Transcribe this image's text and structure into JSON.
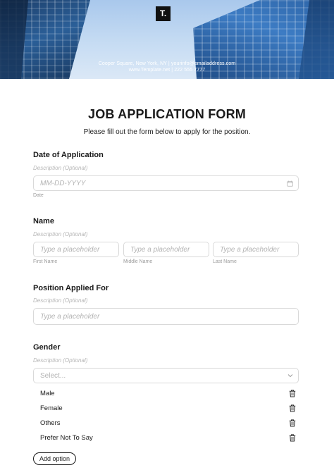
{
  "header": {
    "logo_letter": "T.",
    "contact_line1": "Cooper Square, New York, NY  |  yourinfo@emailaddress.com",
    "contact_line2": "www.Template.net  |  222 555 7777"
  },
  "form": {
    "title": "JOB APPLICATION FORM",
    "subtitle": "Please fill out the form below to apply for the position.",
    "date": {
      "label": "Date of Application",
      "description": "Description (Optional)",
      "placeholder": "MM-DD-YYYY",
      "sublabel": "Date"
    },
    "name": {
      "label": "Name",
      "description": "Description (Optional)",
      "fields": [
        {
          "placeholder": "Type a placeholder",
          "sublabel": "First Name"
        },
        {
          "placeholder": "Type a placeholder",
          "sublabel": "Middle Name"
        },
        {
          "placeholder": "Type a placeholder",
          "sublabel": "Last Name"
        }
      ]
    },
    "position": {
      "label": "Position Applied For",
      "description": "Description (Optional)",
      "placeholder": "Type a placeholder"
    },
    "gender": {
      "label": "Gender",
      "description": "Description (Optional)",
      "select_placeholder": "Select...",
      "options": [
        "Male",
        "Female",
        "Others",
        "Prefer Not To Say"
      ],
      "add_option_label": "Add option"
    }
  }
}
